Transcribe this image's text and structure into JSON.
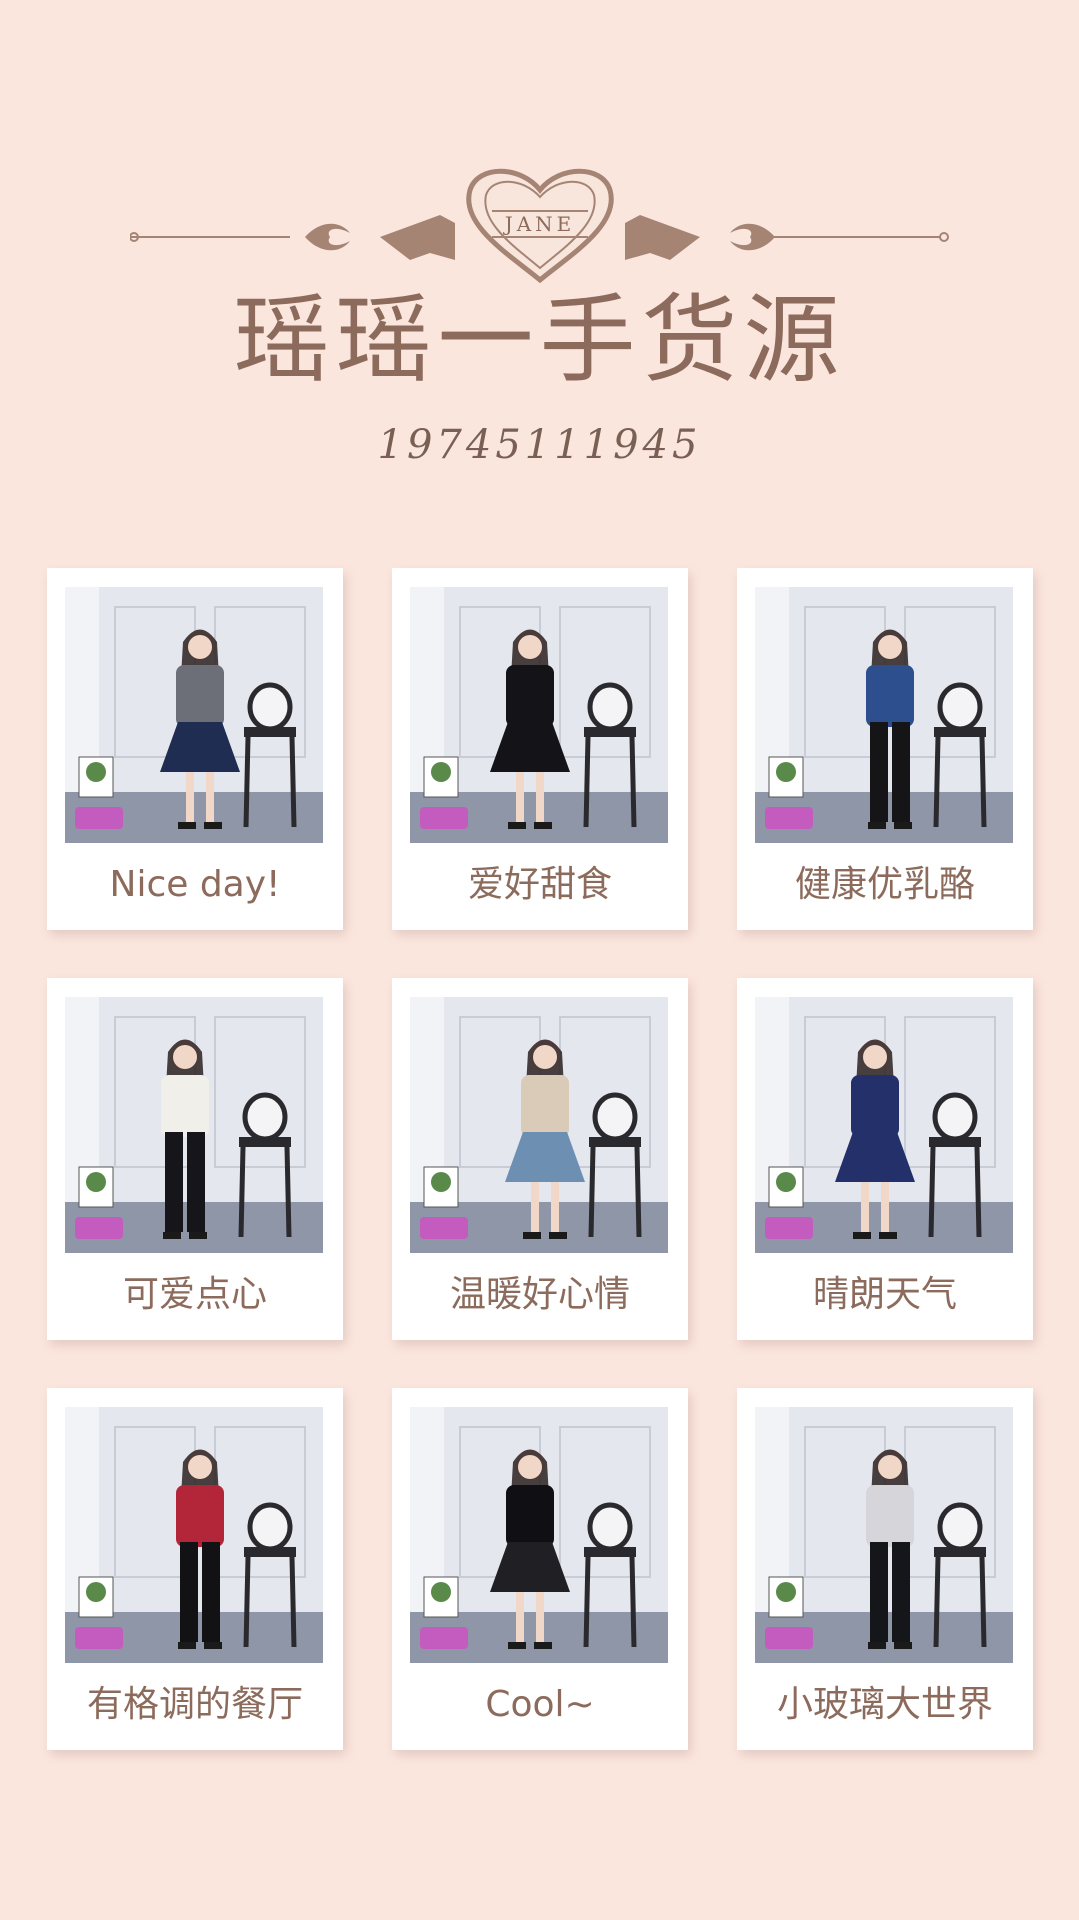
{
  "header": {
    "badge_text": "JANE",
    "title": "瑶瑶一手货源",
    "phone": "19745111945"
  },
  "cards": [
    {
      "label": "Nice day!",
      "outfit": {
        "top": "#6d6f78",
        "bottom": "#1f2d52",
        "skirt": true
      }
    },
    {
      "label": "爱好甜食",
      "outfit": {
        "top": "#141418",
        "bottom": "#141418",
        "skirt": true
      }
    },
    {
      "label": "健康优乳酪",
      "outfit": {
        "top": "#2d4f8e",
        "bottom": "#151518",
        "skirt": false
      }
    },
    {
      "label": "可爱点心",
      "outfit": {
        "top": "#f1efe9",
        "bottom": "#16161a",
        "skirt": false
      }
    },
    {
      "label": "温暖好心情",
      "outfit": {
        "top": "#d9cbb8",
        "bottom": "#6c8fb2",
        "skirt": true
      }
    },
    {
      "label": "晴朗天气",
      "outfit": {
        "top": "#23306a",
        "bottom": "#23306a",
        "skirt": true
      }
    },
    {
      "label": "有格调的餐厅",
      "outfit": {
        "top": "#b3263a",
        "bottom": "#121214",
        "skirt": false
      }
    },
    {
      "label": "Cool~",
      "outfit": {
        "top": "#101014",
        "bottom": "#202024",
        "skirt": true
      }
    },
    {
      "label": "小玻璃大世界",
      "outfit": {
        "top": "#d6d6da",
        "bottom": "#15161a",
        "skirt": false
      }
    }
  ]
}
